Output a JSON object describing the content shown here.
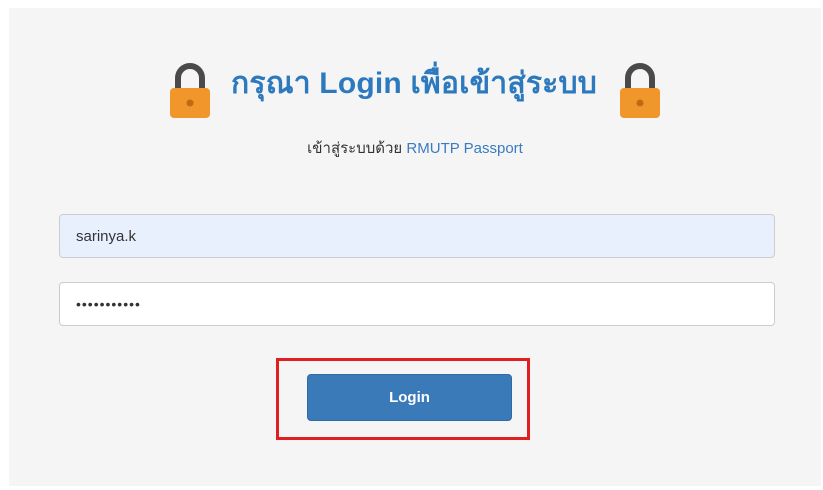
{
  "header": {
    "title": "กรุณา Login เพื่อเข้าสู่ระบบ",
    "left_icon": "lock-icon",
    "right_icon": "lock-icon"
  },
  "subtitle": {
    "prefix": "เข้าสู่ระบบด้วย",
    "link": "RMUTP Passport"
  },
  "form": {
    "username_value": "sarinya.k",
    "password_value": "•••••••••••",
    "login_label": "Login"
  },
  "colors": {
    "accent": "#2c79bd",
    "button": "#3a7ab9",
    "lock": "#f0962a",
    "highlight": "#e02020",
    "autofill": "#e8f0fe"
  }
}
